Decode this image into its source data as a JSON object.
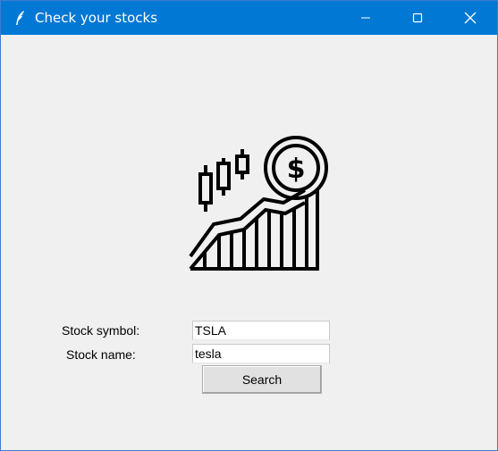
{
  "window": {
    "title": "Check your stocks",
    "title_bar_color": "#0078d4",
    "icon": "feather-icon"
  },
  "caption_buttons": {
    "minimize_icon": "minimize-icon",
    "maximize_icon": "maximize-icon",
    "close_icon": "close-icon"
  },
  "logo": {
    "icon": "stock-growth-dollar-icon"
  },
  "form": {
    "symbol_label": "Stock symbol:",
    "symbol_value": "TSLA",
    "name_label": "Stock name:",
    "name_value": "tesla",
    "search_label": "Search"
  }
}
